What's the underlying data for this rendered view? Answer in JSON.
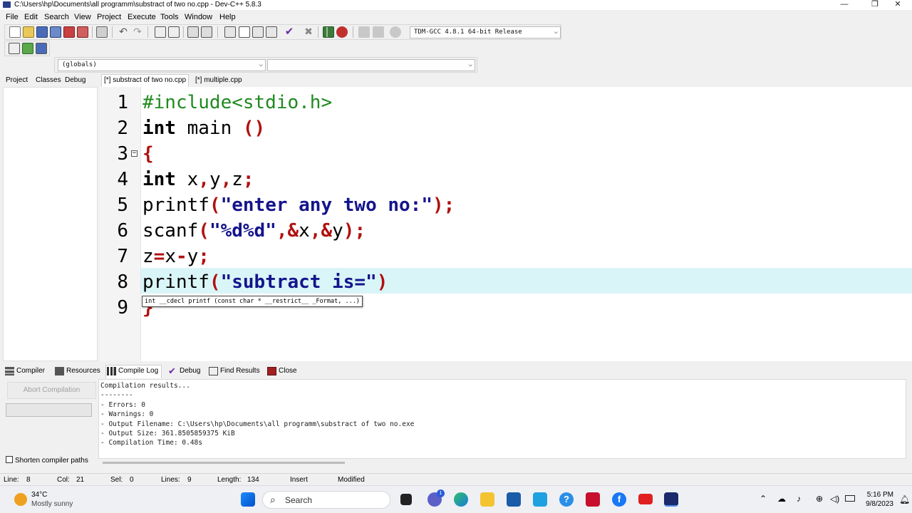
{
  "window": {
    "title": "C:\\Users\\hp\\Documents\\all programm\\substract of two no.cpp - Dev-C++ 5.8.3",
    "minimize": "—",
    "restore": "❐",
    "close": "✕"
  },
  "menu": [
    "File",
    "Edit",
    "Search",
    "View",
    "Project",
    "Execute",
    "Tools",
    "Window",
    "Help"
  ],
  "toolbar": {
    "compiler_select": "TDM-GCC 4.8.1 64-bit Release",
    "scope_select": "(globals)",
    "function_select": ""
  },
  "left_tabs": [
    "Project",
    "Classes",
    "Debug"
  ],
  "file_tabs": [
    "[*] substract of two no.cpp",
    "[*] multiple.cpp"
  ],
  "editor": {
    "line_numbers": [
      "1",
      "2",
      "3",
      "4",
      "5",
      "6",
      "7",
      "8",
      "9"
    ],
    "current_line": 8,
    "fold_marker": "−",
    "tooltip": "int __cdecl printf (const char * __restrict__ _Format, ...)"
  },
  "bottom_tabs": [
    "Compiler",
    "Resources",
    "Compile Log",
    "Debug",
    "Find Results",
    "Close"
  ],
  "compile": {
    "abort_label": "Abort Compilation",
    "shorten_label": "Shorten compiler paths",
    "log": [
      "Compilation results...",
      "--------",
      "- Errors: 0",
      "- Warnings: 0",
      "- Output Filename: C:\\Users\\hp\\Documents\\all programm\\substract of two no.exe",
      "- Output Size: 361.8505859375 KiB",
      "- Compilation Time: 0.48s"
    ]
  },
  "status": {
    "line_label": "Line:",
    "line": "8",
    "col_label": "Col:",
    "col": "21",
    "sel_label": "Sel:",
    "sel": "0",
    "lines_label": "Lines:",
    "lines": "9",
    "length_label": "Length:",
    "length": "134",
    "mode": "Insert",
    "modified": "Modified"
  },
  "taskbar": {
    "temp": "34°C",
    "weather": "Mostly sunny",
    "search": "Search",
    "time": "5:16 PM",
    "date": "9/8/2023",
    "badge": "1"
  },
  "colors": {
    "preprocessor": "#1f8a1f",
    "string": "#14148c",
    "symbol": "#b01010",
    "current_line_bg": "#d9f5f7"
  }
}
